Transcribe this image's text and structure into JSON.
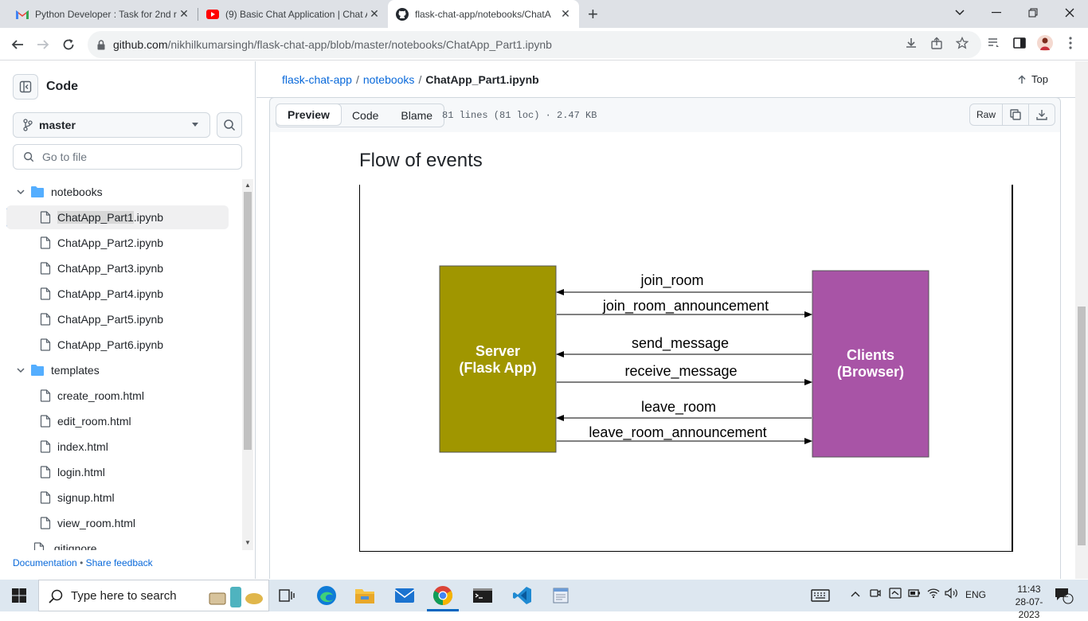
{
  "browser": {
    "tabs": [
      {
        "title": "Python Developer : Task for 2nd r",
        "favicon": "gmail-icon",
        "active": false
      },
      {
        "title": "(9) Basic Chat Application | Chat A",
        "favicon": "youtube-icon",
        "active": false
      },
      {
        "title": "flask-chat-app/notebooks/ChatA",
        "favicon": "github-icon",
        "active": true
      }
    ],
    "new_tab": "+",
    "url_host": "github.com",
    "url_path": "/nikhilkumarsingh/flask-chat-app/blob/master/notebooks/ChatApp_Part1.ipynb"
  },
  "sidebar": {
    "title": "Code",
    "branch": "master",
    "goto_placeholder": "Go to file",
    "tree": [
      {
        "type": "folder",
        "name": "notebooks",
        "expanded": true,
        "level": 0
      },
      {
        "type": "file",
        "name_hl": "ChatApp_Part1",
        "name_rest": ".ipynb",
        "level": 1,
        "selected": true
      },
      {
        "type": "file",
        "name": "ChatApp_Part2.ipynb",
        "level": 1
      },
      {
        "type": "file",
        "name": "ChatApp_Part3.ipynb",
        "level": 1
      },
      {
        "type": "file",
        "name": "ChatApp_Part4.ipynb",
        "level": 1
      },
      {
        "type": "file",
        "name": "ChatApp_Part5.ipynb",
        "level": 1
      },
      {
        "type": "file",
        "name": "ChatApp_Part6.ipynb",
        "level": 1
      },
      {
        "type": "folder",
        "name": "templates",
        "expanded": true,
        "level": 0
      },
      {
        "type": "file",
        "name": "create_room.html",
        "level": 1
      },
      {
        "type": "file",
        "name": "edit_room.html",
        "level": 1
      },
      {
        "type": "file",
        "name": "index.html",
        "level": 1
      },
      {
        "type": "file",
        "name": "login.html",
        "level": 1
      },
      {
        "type": "file",
        "name": "signup.html",
        "level": 1
      },
      {
        "type": "file",
        "name": "view_room.html",
        "level": 1
      },
      {
        "type": "file",
        "name": ".gitignore",
        "level": 0
      }
    ],
    "footer": {
      "documentation": "Documentation",
      "separator": "•",
      "feedback": "Share feedback"
    }
  },
  "main": {
    "breadcrumb": {
      "repo": "flask-chat-app",
      "sep": "/",
      "folder": "notebooks",
      "file": "ChatApp_Part1.ipynb"
    },
    "top_label": "Top",
    "view_tabs": [
      "Preview",
      "Code",
      "Blame"
    ],
    "active_view": "Preview",
    "file_info": "81 lines (81 loc) · 2.47 KB",
    "raw_label": "Raw",
    "heading": "Flow of events"
  },
  "diagram": {
    "server": {
      "line1": "Server",
      "line2": "(Flask App)",
      "color": "#a09600"
    },
    "clients": {
      "line1": "Clients",
      "line2": "(Browser)",
      "color": "#a854a6"
    },
    "events": [
      {
        "label": "join_room",
        "direction": "to_server"
      },
      {
        "label": "join_room_announcement",
        "direction": "to_clients"
      },
      {
        "label": "send_message",
        "direction": "to_server"
      },
      {
        "label": "receive_message",
        "direction": "to_clients"
      },
      {
        "label": "leave_room",
        "direction": "to_server"
      },
      {
        "label": "leave_room_announcement",
        "direction": "to_clients"
      }
    ]
  },
  "taskbar": {
    "search_placeholder": "Type here to search",
    "language": "ENG",
    "time": "11:43",
    "date": "28-07-2023",
    "notification_count": "2"
  }
}
